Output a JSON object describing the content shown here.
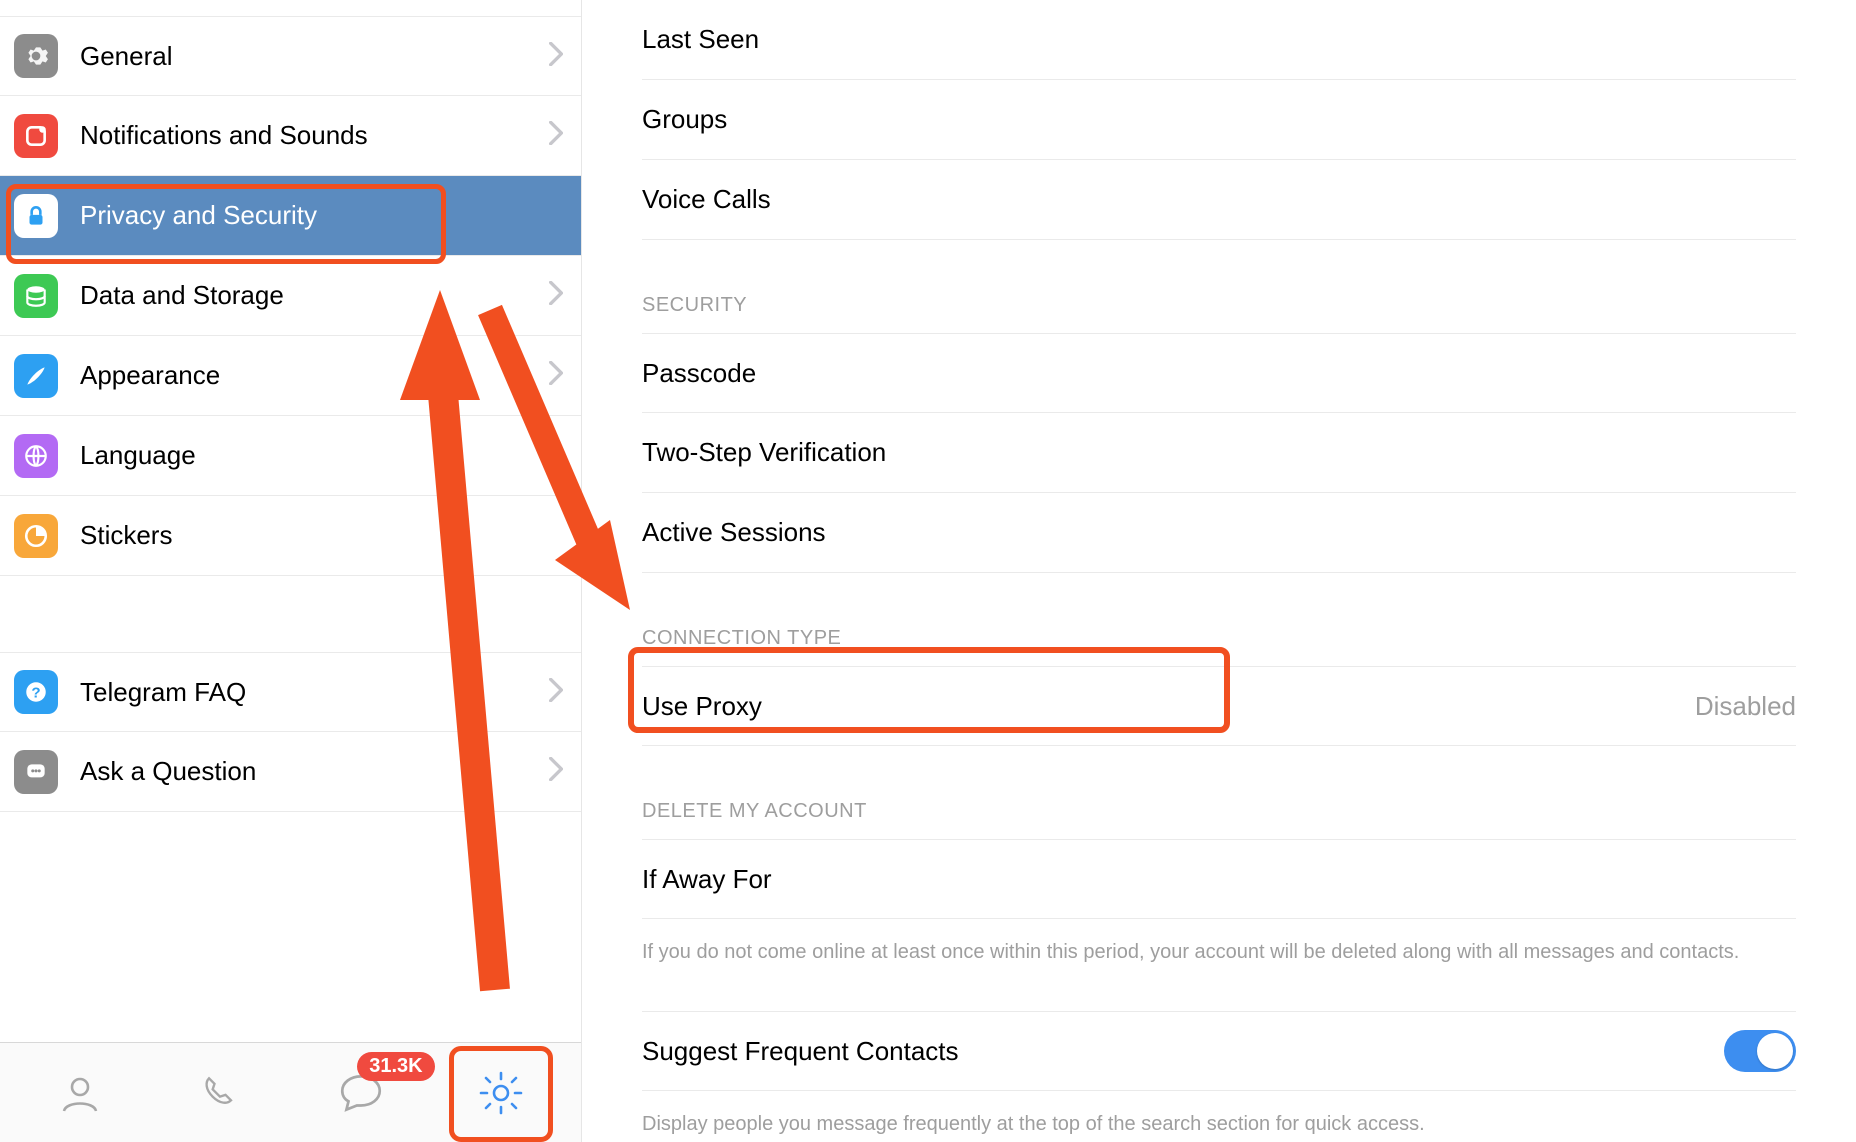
{
  "sidebar": {
    "items": [
      {
        "label": "General",
        "icon": "gear-icon",
        "color": "#8c8c8c"
      },
      {
        "label": "Notifications and Sounds",
        "icon": "bell-icon",
        "color": "#f04a3f"
      },
      {
        "label": "Privacy and Security",
        "icon": "lock-icon",
        "color": "#2da0f2",
        "selected": true
      },
      {
        "label": "Data and Storage",
        "icon": "database-icon",
        "color": "#3dc954"
      },
      {
        "label": "Appearance",
        "icon": "brush-icon",
        "color": "#2da0f2"
      },
      {
        "label": "Language",
        "icon": "globe-icon",
        "color": "#b36af4",
        "no_chev": true
      },
      {
        "label": "Stickers",
        "icon": "sticker-icon",
        "color": "#f8a73a",
        "no_chev": true
      }
    ],
    "support": [
      {
        "label": "Telegram FAQ",
        "icon": "help-icon",
        "color": "#2da0f2"
      },
      {
        "label": "Ask a Question",
        "icon": "chat-icon",
        "color": "#8c8c8c"
      }
    ]
  },
  "tabbar": {
    "badge": "31.3K",
    "active_tab": "settings"
  },
  "content": {
    "privacy_rows": [
      {
        "label": "Last Seen"
      },
      {
        "label": "Groups"
      },
      {
        "label": "Voice Calls"
      }
    ],
    "security_header": "SECURITY",
    "security_rows": [
      {
        "label": "Passcode"
      },
      {
        "label": "Two-Step Verification"
      },
      {
        "label": "Active Sessions"
      }
    ],
    "connection_header": "CONNECTION TYPE",
    "connection_rows": [
      {
        "label": "Use Proxy",
        "value": "Disabled"
      }
    ],
    "delete_header": "DELETE MY ACCOUNT",
    "delete_rows": [
      {
        "label": "If Away For"
      }
    ],
    "delete_desc": "If you do not come online at least once within this period, your account will be deleted along with all messages and contacts.",
    "suggest_label": "Suggest Frequent Contacts",
    "suggest_toggle": true,
    "suggest_desc": "Display people you message frequently at the top of the search section for quick access."
  },
  "annotations": {
    "arrow1": "arrow pointing up to Privacy and Security",
    "arrow2": "arrow pointing right to Use Proxy",
    "highlight_boxes": [
      "privacy-and-security-row",
      "use-proxy-row",
      "settings-tab"
    ]
  }
}
